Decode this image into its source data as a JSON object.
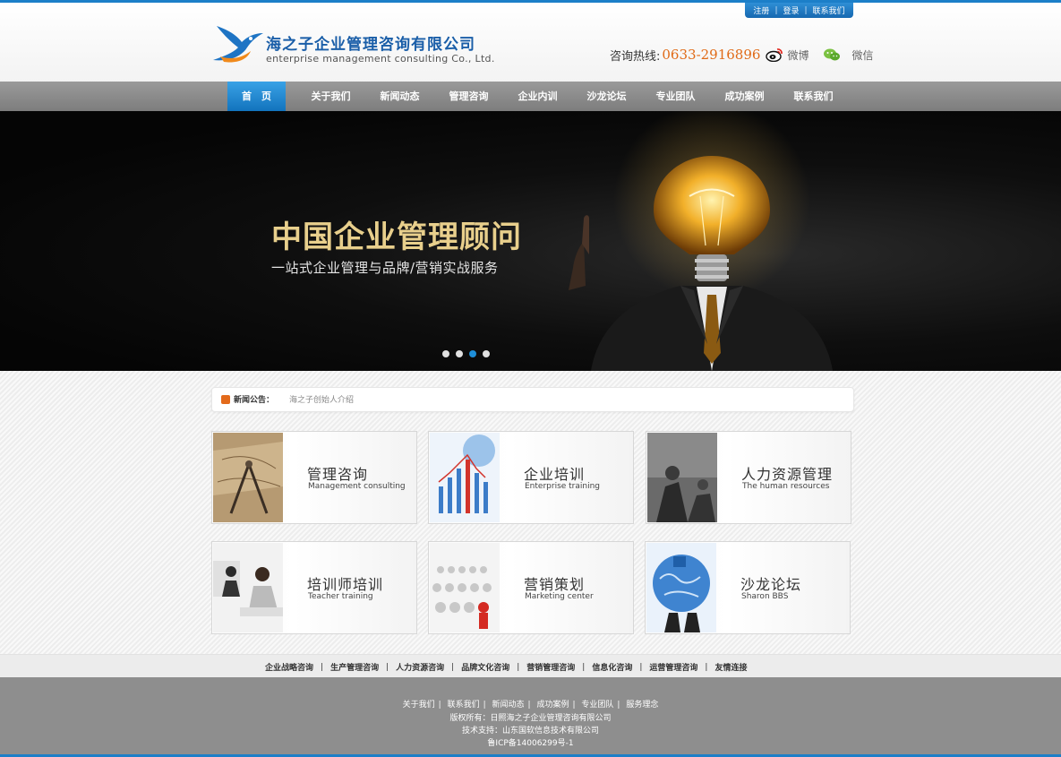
{
  "toplinks": [
    "注册",
    "登录",
    "联系我们"
  ],
  "logo": {
    "cn": "海之子企业管理咨询有限公司",
    "en": "enterprise management consulting Co., Ltd."
  },
  "hotline": {
    "label": "咨询热线:",
    "number": "0633-2916896",
    "weibo": "微博",
    "wechat": "微信"
  },
  "nav": [
    "首　页",
    "关于我们",
    "新闻动态",
    "管理咨询",
    "企业内训",
    "沙龙论坛",
    "专业团队",
    "成功案例",
    "联系我们"
  ],
  "banner": {
    "title": "中国企业管理顾问",
    "subtitle": "一站式企业管理与品牌/营销实战服务",
    "slide_count": 4,
    "active_slide": 3
  },
  "news": {
    "label": "新闻公告：",
    "item": "海之子创始人介绍"
  },
  "cards": [
    {
      "title": "管理咨询",
      "subtitle": "Management consulting",
      "icon": "compass-map-icon"
    },
    {
      "title": "企业培训",
      "subtitle": "Enterprise training",
      "icon": "bar-chart-icon"
    },
    {
      "title": "人力资源管理",
      "subtitle": "The human resources",
      "icon": "people-chess-icon"
    },
    {
      "title": "培训师培训",
      "subtitle": "Teacher training",
      "icon": "meeting-icon"
    },
    {
      "title": "营销策划",
      "subtitle": "Marketing center",
      "icon": "crowd-icon"
    },
    {
      "title": "沙龙论坛",
      "subtitle": "Sharon BBS",
      "icon": "globe-puzzle-icon"
    }
  ],
  "links": [
    "企业战略咨询",
    "生产管理咨询",
    "人力资源咨询",
    "品牌文化咨询",
    "营销管理咨询",
    "信息化咨询",
    "运营管理咨询",
    "友情连接"
  ],
  "footer": {
    "nav": [
      "关于我们",
      "联系我们",
      "新闻动态",
      "成功案例",
      "专业团队",
      "服务理念"
    ],
    "copyright": "版权所有：日照海之子企业管理咨询有限公司",
    "support": "技术支持：山东国软信息技术有限公司",
    "icp": "鲁ICP备14006299号-1"
  },
  "colors": {
    "accent": "#1c7fc8",
    "nav_bg": "#8a8a8a",
    "hotline": "#e06a17",
    "banner_title": "#e8cf8c"
  }
}
